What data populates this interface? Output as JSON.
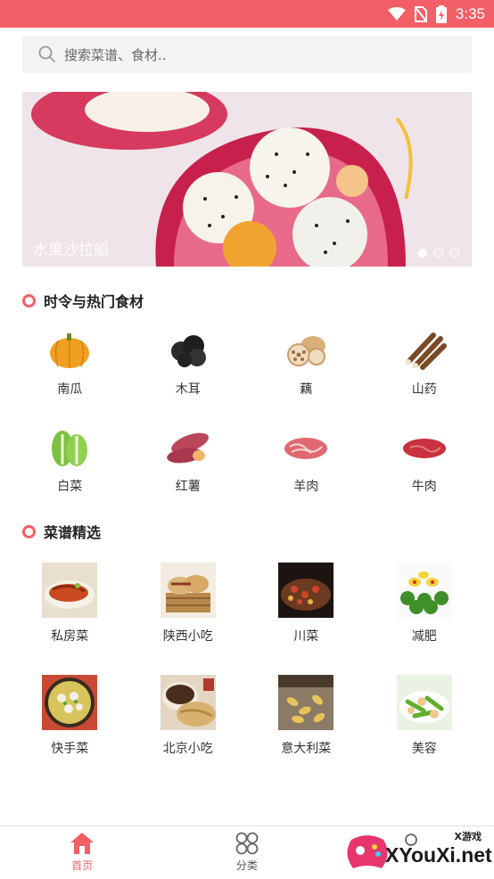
{
  "status_bar": {
    "time": "3:35",
    "background": "#f25f66"
  },
  "search": {
    "placeholder": "搜索菜谱、食材.."
  },
  "banner": {
    "caption": "水果沙拉船",
    "dot_count": 3,
    "active_dot": 0
  },
  "ingredients_section": {
    "title": "时令与热门食材",
    "items": [
      {
        "label": "南瓜",
        "icon": "pumpkin-icon"
      },
      {
        "label": "木耳",
        "icon": "wood-ear-icon"
      },
      {
        "label": "藕",
        "icon": "lotus-root-icon"
      },
      {
        "label": "山药",
        "icon": "yam-icon"
      },
      {
        "label": "白菜",
        "icon": "cabbage-icon"
      },
      {
        "label": "红薯",
        "icon": "sweet-potato-icon"
      },
      {
        "label": "羊肉",
        "icon": "lamb-icon"
      },
      {
        "label": "牛肉",
        "icon": "beef-icon"
      }
    ]
  },
  "recipes_section": {
    "title": "菜谱精选",
    "items": [
      {
        "label": "私房菜"
      },
      {
        "label": "陕西小吃"
      },
      {
        "label": "川菜"
      },
      {
        "label": "减肥"
      },
      {
        "label": "快手菜"
      },
      {
        "label": "北京小吃"
      },
      {
        "label": "意大利菜"
      },
      {
        "label": "美容"
      }
    ]
  },
  "bottom_nav": {
    "items": [
      {
        "label": "首页",
        "icon": "home-icon",
        "active": true
      },
      {
        "label": "分类",
        "icon": "category-icon",
        "active": false
      }
    ]
  },
  "watermark": {
    "small": "X游戏",
    "text": "XYouXi.net"
  },
  "colors": {
    "accent": "#f25f66"
  }
}
